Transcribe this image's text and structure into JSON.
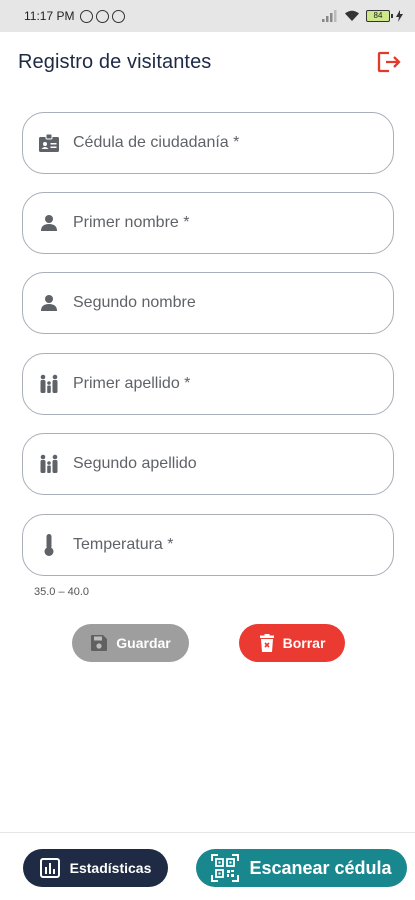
{
  "status_bar": {
    "time": "11:17 PM",
    "battery": "84"
  },
  "header": {
    "title": "Registro de visitantes"
  },
  "fields": [
    {
      "label": "Cédula de ciudadanía *",
      "icon": "id-card-icon"
    },
    {
      "label": "Primer nombre *",
      "icon": "person-icon"
    },
    {
      "label": "Segundo nombre",
      "icon": "person-icon"
    },
    {
      "label": "Primer apellido *",
      "icon": "family-icon"
    },
    {
      "label": "Segundo apellido",
      "icon": "family-icon"
    },
    {
      "label": "Temperatura *",
      "icon": "thermometer-icon"
    }
  ],
  "temperature_hint": "35.0 – 40.0",
  "actions": {
    "save_label": "Guardar",
    "clear_label": "Borrar"
  },
  "bottom_bar": {
    "stats_label": "Estadísticas",
    "scan_label": "Escanear cédula"
  },
  "colors": {
    "primary": "#1f2b44",
    "danger": "#ea3a32",
    "teal": "#19878e",
    "disabled": "#9e9e9e"
  }
}
